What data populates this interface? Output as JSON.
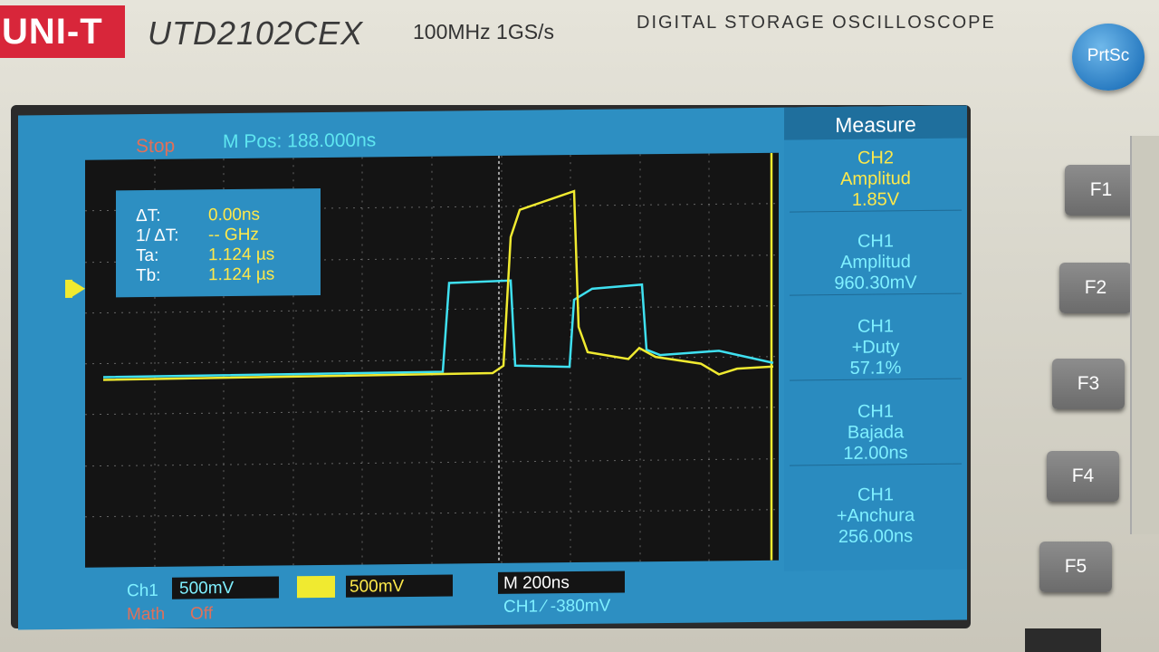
{
  "header": {
    "brand": "UNI-T",
    "model": "UTD2102CEX",
    "spec": "100MHz  1GS/s",
    "description": "DIGITAL STORAGE OSCILLOSCOPE"
  },
  "buttons": {
    "prtsc": "PrtSc",
    "f1": "F1",
    "f2": "F2",
    "f3": "F3",
    "f4": "F4",
    "f5": "F5"
  },
  "status": {
    "run_state": "Stop",
    "m_pos": "M Pos: 188.000ns"
  },
  "cursor": {
    "dt_label": "ΔT:",
    "dt_value": "0.00ns",
    "inv_label": "1/ ΔT:",
    "inv_value": "-- GHz",
    "ta_label": "Ta:",
    "ta_value": "1.124 µs",
    "tb_label": "Tb:",
    "tb_value": "1.124 µs"
  },
  "measure": {
    "title": "Measure",
    "items": [
      {
        "ch": "CH2",
        "name": "Amplitud",
        "value": "1.85V",
        "color": "#ffe94a"
      },
      {
        "ch": "CH1",
        "name": "Amplitud",
        "value": "960.30mV",
        "color": "#7ff0ff"
      },
      {
        "ch": "CH1",
        "name": "+Duty",
        "value": "57.1%",
        "color": "#7ff0ff"
      },
      {
        "ch": "CH1",
        "name": "Bajada",
        "value": "12.00ns",
        "color": "#7ff0ff"
      },
      {
        "ch": "CH1",
        "name": "+Anchura",
        "value": "256.00ns",
        "color": "#7ff0ff"
      }
    ]
  },
  "bottom": {
    "ch1_label": "Ch1",
    "ch1_scale": "500mV",
    "ch2_scale": "500mV",
    "math_label": "Math",
    "math_state": "Off",
    "timebase": "M 200ns",
    "trigger": "CH1  ⁄  -380mV"
  },
  "colors": {
    "ch1": "#3fe0f0",
    "ch2": "#f0ea30",
    "screen_bg": "#2d8fc2",
    "grid_bg": "#141414",
    "brand_red": "#d8263a",
    "prtsc_blue": "#2a7cc2"
  }
}
